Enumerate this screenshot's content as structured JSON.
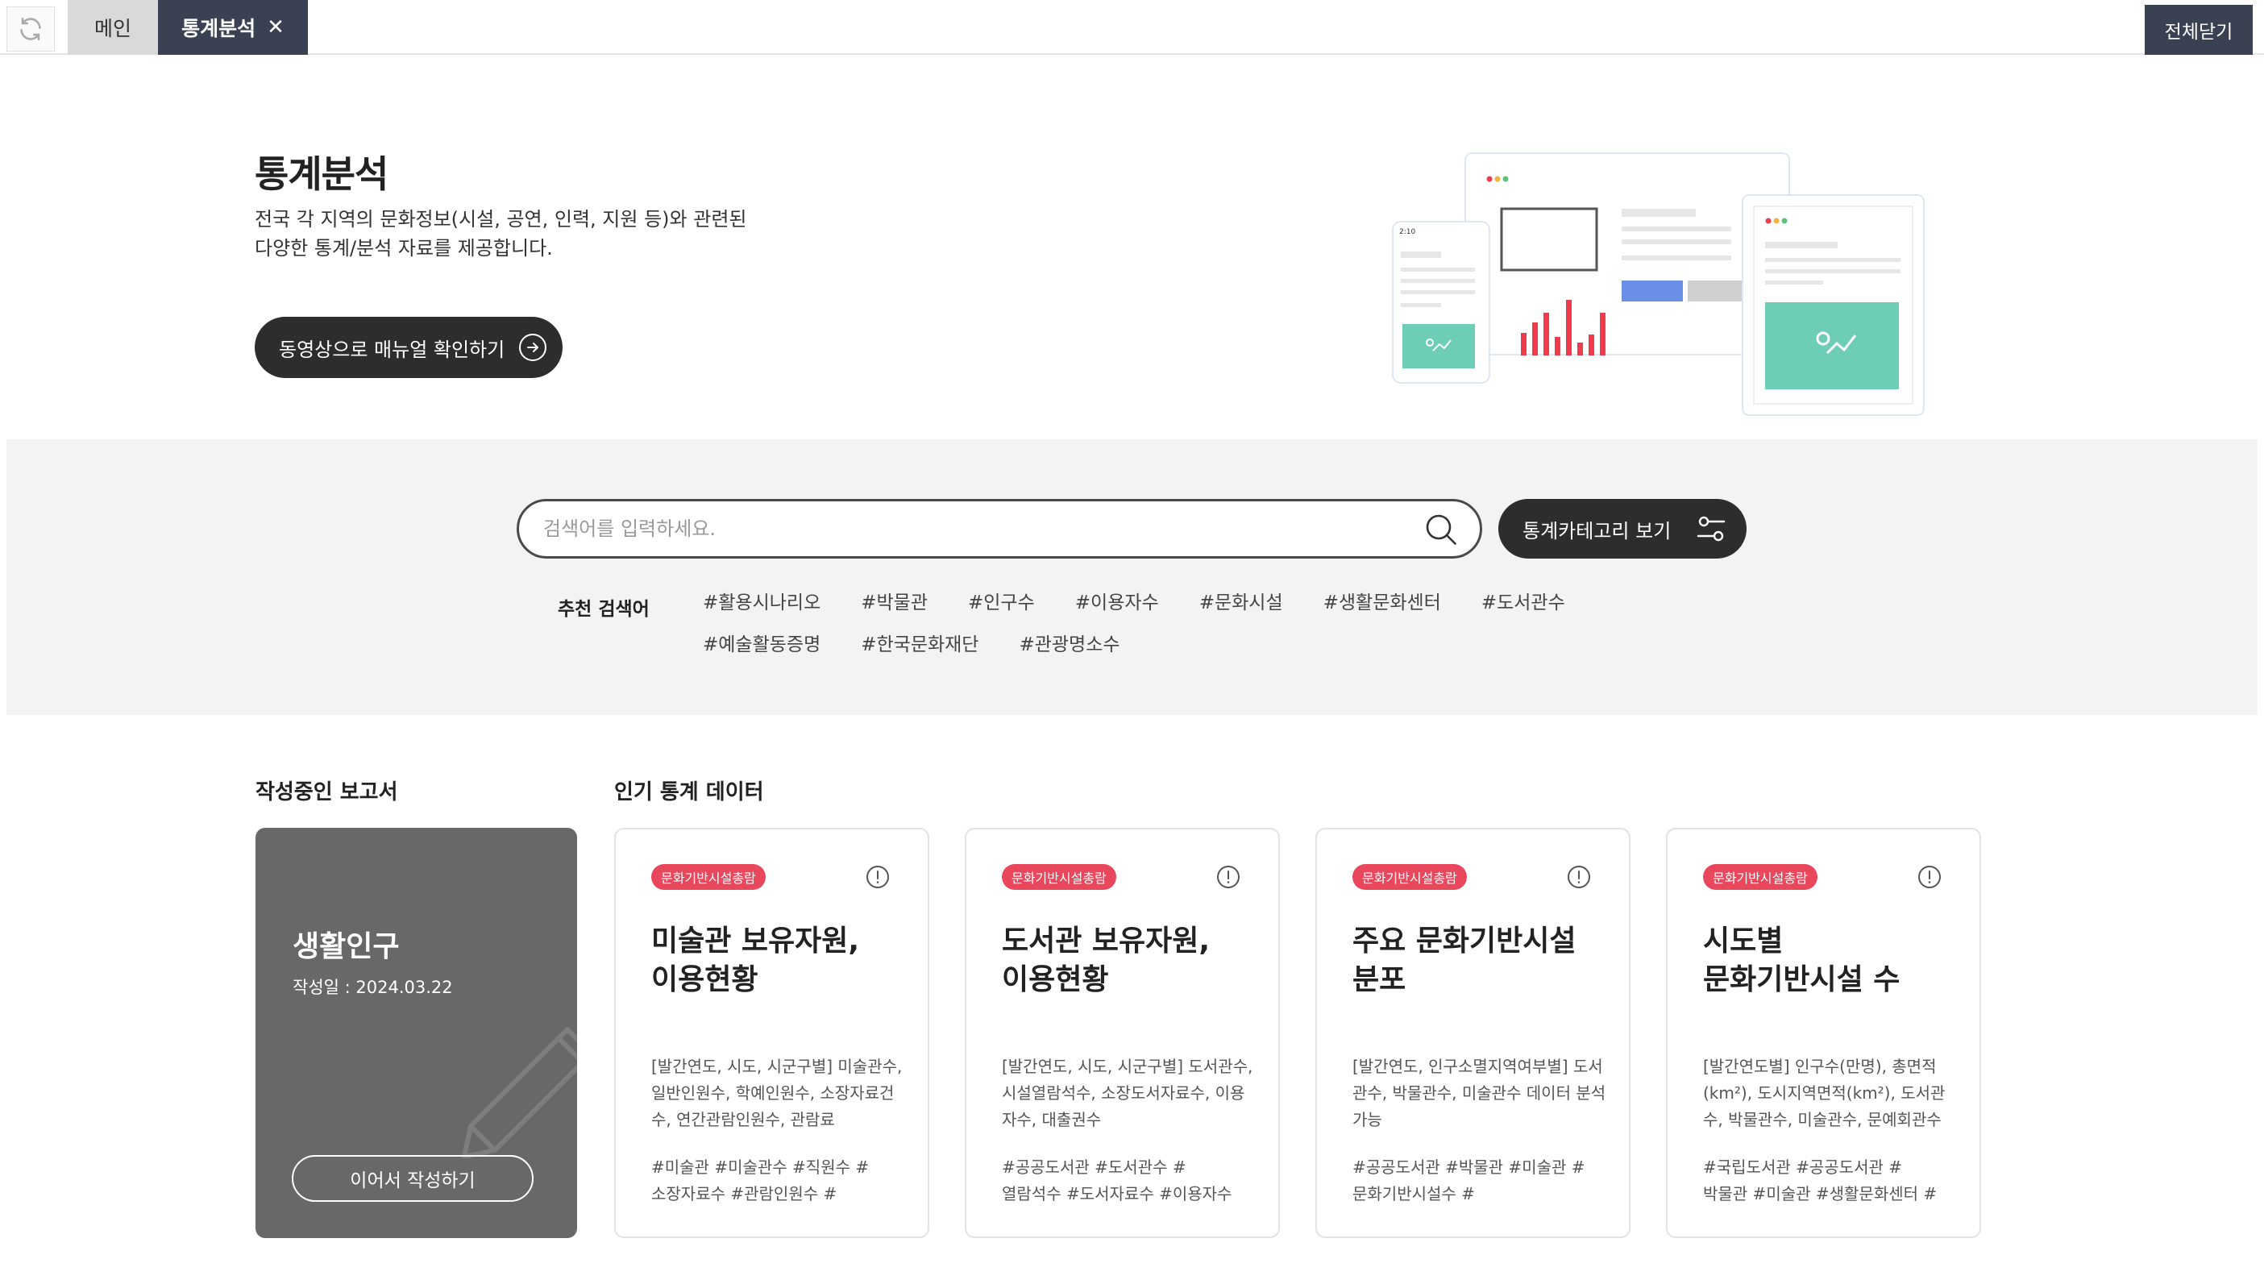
{
  "tabs": {
    "main_label": "메인",
    "active_label": "통계분석",
    "close_symbol": "✕",
    "close_all_label": "전체닫기"
  },
  "hero": {
    "title": "통계분석",
    "desc_line1": "전국 각 지역의 문화정보(시설, 공연, 인력, 지원 등)와 관련된",
    "desc_line2": "다양한 통계/분석 자료를 제공합니다.",
    "video_button_label": "동영상으로 매뉴얼 확인하기",
    "illustration_time": "2:10"
  },
  "search": {
    "placeholder": "검색어를 입력하세요.",
    "value": "",
    "category_button_label": "통계카테고리 보기",
    "recommended_label": "추천 검색어",
    "recommended_tags": [
      "#활용시나리오",
      "#박물관",
      "#인구수",
      "#이용자수",
      "#문화시설",
      "#생활문화센터",
      "#도서관수",
      "#예술활동증명",
      "#한국문화재단",
      "#관광명소수"
    ]
  },
  "drafts": {
    "section_title": "작성중인 보고서",
    "card": {
      "title": "생활인구",
      "date": "작성일 : 2024.03.22",
      "continue_label": "이어서 작성하기"
    }
  },
  "popular": {
    "section_title": "인기 통계 데이터",
    "cards": [
      {
        "badge": "문화기반시설총람",
        "title_line1": "미술관 보유자원,",
        "title_line2": "이용현황",
        "desc": "[발간연도, 시도, 시군구별] 미술관수, 일반인원수, 학예인원수, 소장자료건수, 연간관람인원수, 관람료",
        "tags_line1": "#미술관 #미술관수 #직원수 #",
        "tags_line2": "소장자료수 #관람인원수 #"
      },
      {
        "badge": "문화기반시설총람",
        "title_line1": "도서관 보유자원,",
        "title_line2": "이용현황",
        "desc": "[발간연도, 시도, 시군구별] 도서관수, 시설열람석수, 소장도서자료수, 이용자수, 대출권수",
        "tags_line1": "#공공도서관 #도서관수 #",
        "tags_line2": "열람석수 #도서자료수 #이용자수"
      },
      {
        "badge": "문화기반시설총람",
        "title_line1": "주요 문화기반시설",
        "title_line2": "분포",
        "desc": "[발간연도, 인구소멸지역여부별] 도서관수, 박물관수, 미술관수 데이터 분석 가능",
        "tags_line1": "#공공도서관 #박물관 #미술관 #",
        "tags_line2": "문화기반시설수 #"
      },
      {
        "badge": "문화기반시설총람",
        "title_line1": "시도별",
        "title_line2": "문화기반시설 수",
        "desc": "[발간연도별] 인구수(만명), 총면적(km²), 도시지역면적(km²), 도서관수, 박물관수, 미술관수, 문예회관수",
        "tags_line1": "#국립도서관 #공공도서관 #",
        "tags_line2": "박물관 #미술관 #생활문화센터 #"
      }
    ]
  },
  "colors": {
    "dark_button": "#2d2d2d",
    "tab_active": "#3a4153",
    "badge": "#e8475c",
    "draft_card": "#686868",
    "illustration_green": "#6ecdb6",
    "illustration_blue": "#6a8fe6",
    "illustration_red": "#ef3b4c"
  }
}
